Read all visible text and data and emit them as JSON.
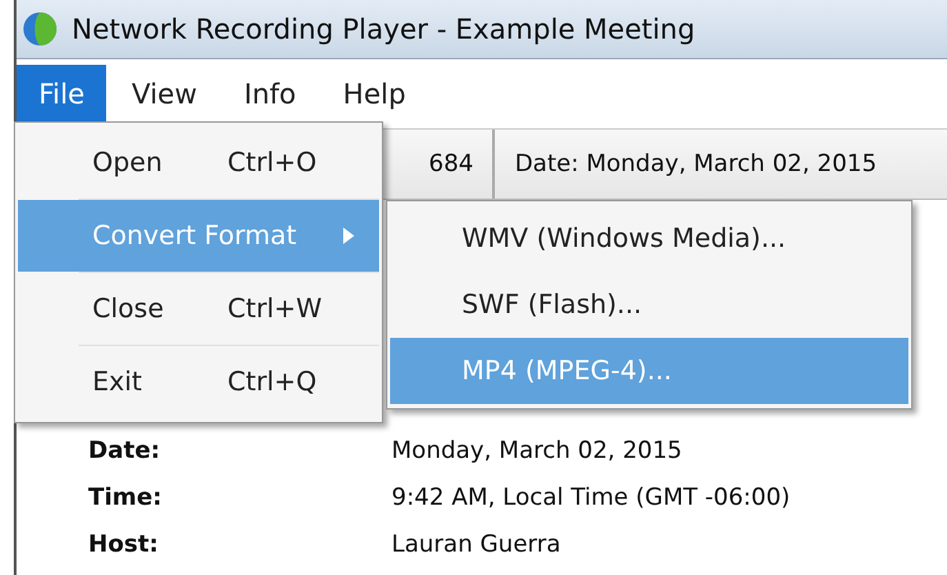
{
  "window": {
    "title": "Network Recording Player - Example Meeting"
  },
  "menu_bar": [
    {
      "label": "File",
      "selected": true
    },
    {
      "label": "View",
      "selected": false
    },
    {
      "label": "Info",
      "selected": false
    },
    {
      "label": "Help",
      "selected": false
    }
  ],
  "toolbar": {
    "fields": [
      {
        "text": "684"
      },
      {
        "text": "Date: Monday, March 02, 2015"
      }
    ]
  },
  "file_menu": [
    {
      "label": "Open",
      "shortcut": "Ctrl+O",
      "submenu": false,
      "selected": false
    },
    {
      "label": "Convert Format",
      "submenu": true,
      "selected": true
    },
    {
      "label": "Close",
      "shortcut": "Ctrl+W",
      "submenu": false,
      "selected": false
    },
    {
      "label": "Exit",
      "shortcut": "Ctrl+Q",
      "submenu": false,
      "selected": false
    }
  ],
  "convert_submenu": [
    {
      "label": "WMV (Windows Media)...",
      "selected": false
    },
    {
      "label": "SWF (Flash)...",
      "selected": false
    },
    {
      "label": "MP4 (MPEG-4)...",
      "selected": true
    }
  ],
  "details": [
    {
      "label": "Date:",
      "value": "Monday, March 02, 2015"
    },
    {
      "label": "Time:",
      "value": "9:42 AM, Local Time (GMT -06:00)"
    },
    {
      "label": "Host:",
      "value": "Lauran Guerra"
    }
  ]
}
